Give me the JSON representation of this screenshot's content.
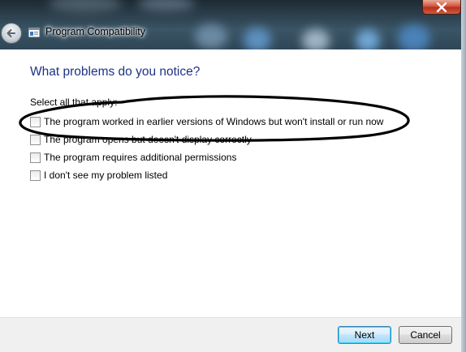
{
  "window": {
    "title": "Program Compatibility",
    "close_icon": "close-icon",
    "back_icon": "back-arrow-icon",
    "app_icon": "wizard-icon"
  },
  "content": {
    "heading": "What problems do you notice?",
    "instruction": "Select all that apply:",
    "options": [
      {
        "label": "The program worked in earlier versions of Windows but won't install or run now",
        "checked": false
      },
      {
        "label": "The program opens but doesn't display correctly",
        "checked": false
      },
      {
        "label": "The program requires additional permissions",
        "checked": false
      },
      {
        "label": "I don't see my problem listed",
        "checked": false
      }
    ]
  },
  "buttons": {
    "next": "Next",
    "cancel": "Cancel"
  },
  "colors": {
    "heading": "#1e3287",
    "annotation_ellipse": "#000000"
  }
}
